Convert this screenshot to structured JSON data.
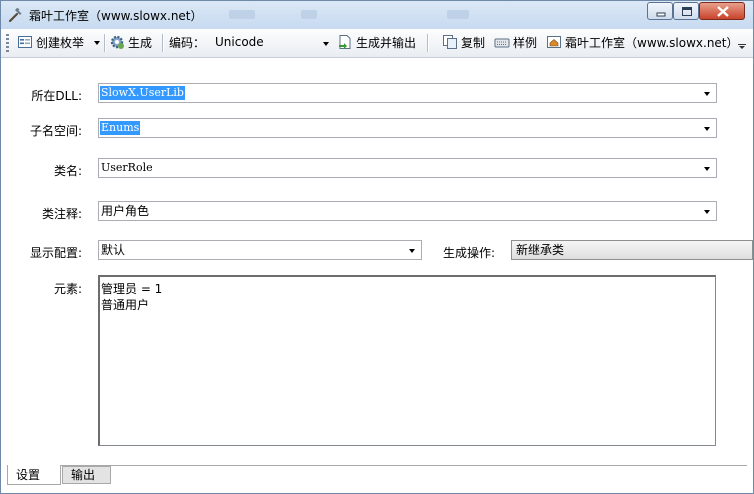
{
  "window": {
    "title": "霜叶工作室（www.slowx.net）",
    "controls": {
      "minimize": "minimize",
      "maximize": "maximize",
      "close": "close"
    }
  },
  "toolbar": {
    "create_enum_label": "创建枚举",
    "generate_label": "生成",
    "encoding_label": "编码：",
    "encoding_value": "Unicode",
    "generate_output_label": "生成并输出",
    "copy_label": "复制",
    "sample_label": "样例",
    "studio_label": "霜叶工作室（www.slowx.net）"
  },
  "form": {
    "dll_label": "所在DLL:",
    "dll_value": "SlowX.UserLib",
    "namespace_label": "子名空间:",
    "namespace_value": "Enums",
    "class_label": "类名:",
    "class_value": "UserRole",
    "comment_label": "类注释:",
    "comment_value": "用户角色",
    "display_label": "显示配置:",
    "display_value": "默认",
    "operation_label": "生成操作:",
    "operation_value": "新继承类",
    "elements_label": "元素:",
    "elements_lines": [
      "管理员 = 1",
      "普通用户"
    ]
  },
  "tabs": {
    "settings": "设置",
    "output": "输出"
  },
  "colors": {
    "selection": "#3399ff",
    "title_bar": "#c7daf0",
    "close_button": "#c9432a"
  }
}
